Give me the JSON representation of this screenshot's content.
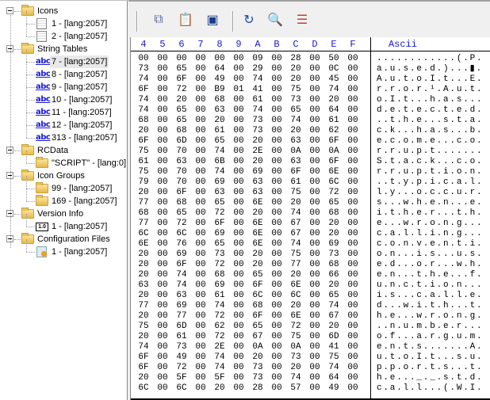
{
  "tree": [
    {
      "level": 0,
      "type": "folder",
      "label": "Icons"
    },
    {
      "level": 1,
      "type": "icon",
      "label": "1 - [lang:2057]"
    },
    {
      "level": 1,
      "type": "icon",
      "label": "2 - [lang:2057]"
    },
    {
      "level": 0,
      "type": "folder",
      "label": "String Tables"
    },
    {
      "level": 1,
      "type": "abc",
      "label": "7 - [lang:2057]",
      "selected": true
    },
    {
      "level": 1,
      "type": "abc",
      "label": "8 - [lang:2057]"
    },
    {
      "level": 1,
      "type": "abc",
      "label": "9 - [lang:2057]"
    },
    {
      "level": 1,
      "type": "abc",
      "label": "10 - [lang:2057]"
    },
    {
      "level": 1,
      "type": "abc",
      "label": "11 - [lang:2057]"
    },
    {
      "level": 1,
      "type": "abc",
      "label": "12 - [lang:2057]"
    },
    {
      "level": 1,
      "type": "abc",
      "label": "313 - [lang:2057]"
    },
    {
      "level": 0,
      "type": "folder",
      "label": "RCData"
    },
    {
      "level": 1,
      "type": "folder",
      "label": "\"SCRIPT\" - [lang:0]"
    },
    {
      "level": 0,
      "type": "folder",
      "label": "Icon Groups"
    },
    {
      "level": 1,
      "type": "folder",
      "label": "99 - [lang:2057]"
    },
    {
      "level": 1,
      "type": "folder",
      "label": "169 - [lang:2057]"
    },
    {
      "level": 0,
      "type": "folder",
      "label": "Version Info"
    },
    {
      "level": 1,
      "type": "version",
      "label": "1 - [lang:2057]"
    },
    {
      "level": 0,
      "type": "folder",
      "label": "Configuration Files"
    },
    {
      "level": 1,
      "type": "config",
      "label": "1 - [lang:2057]"
    }
  ],
  "abc_text": "abc",
  "version_text": "1.0",
  "toolbar": [
    {
      "name": "copy-icon",
      "glyph": "⧉",
      "color": "#5a6fa0"
    },
    {
      "name": "paste-icon",
      "glyph": "📋",
      "color": "#a08040"
    },
    {
      "name": "replace-resource-icon",
      "glyph": "▣",
      "color": "#1a3a8a"
    },
    {
      "name": "refresh-icon",
      "glyph": "↻",
      "color": "#1a4aa0"
    },
    {
      "name": "find-icon",
      "glyph": "🔍",
      "color": "#5080b0"
    },
    {
      "name": "hex-view-icon",
      "glyph": "☰",
      "color": "#c04030"
    }
  ],
  "hex_header": [
    "4",
    "5",
    "6",
    "7",
    "8",
    "9",
    "A",
    "B",
    "C",
    "D",
    "E",
    "F"
  ],
  "ascii_header": "Ascii",
  "rows": [
    {
      "hex": [
        "00",
        "00",
        "00",
        "00",
        "00",
        "00",
        "09",
        "00",
        "28",
        "00",
        "50",
        "00"
      ],
      "ascii": "............(.P."
    },
    {
      "hex": [
        "73",
        "00",
        "65",
        "00",
        "64",
        "00",
        "29",
        "00",
        "20",
        "00",
        "0C",
        "00"
      ],
      "ascii": "a.u.s.e.d.)...▮."
    },
    {
      "hex": [
        "74",
        "00",
        "6F",
        "00",
        "49",
        "00",
        "74",
        "00",
        "20",
        "00",
        "45",
        "00"
      ],
      "ascii": "A.u.t.o.I.t...E."
    },
    {
      "hex": [
        "6F",
        "00",
        "72",
        "00",
        "B9",
        "01",
        "41",
        "00",
        "75",
        "00",
        "74",
        "00"
      ],
      "ascii": "r.r.o.r.¹.A.u.t."
    },
    {
      "hex": [
        "74",
        "00",
        "20",
        "00",
        "68",
        "00",
        "61",
        "00",
        "73",
        "00",
        "20",
        "00"
      ],
      "ascii": "o.I.t...h.a.s..."
    },
    {
      "hex": [
        "74",
        "00",
        "65",
        "00",
        "63",
        "00",
        "74",
        "00",
        "65",
        "00",
        "64",
        "00"
      ],
      "ascii": "d.e.t.e.c.t.e.d."
    },
    {
      "hex": [
        "68",
        "00",
        "65",
        "00",
        "20",
        "00",
        "73",
        "00",
        "74",
        "00",
        "61",
        "00"
      ],
      "ascii": "..t.h.e...s.t.a."
    },
    {
      "hex": [
        "20",
        "00",
        "68",
        "00",
        "61",
        "00",
        "73",
        "00",
        "20",
        "00",
        "62",
        "00"
      ],
      "ascii": "c.k...h.a.s...b."
    },
    {
      "hex": [
        "6F",
        "00",
        "6D",
        "00",
        "65",
        "00",
        "20",
        "00",
        "63",
        "00",
        "6F",
        "00"
      ],
      "ascii": "e.c.o.m.e...c.o."
    },
    {
      "hex": [
        "75",
        "00",
        "70",
        "00",
        "74",
        "00",
        "2E",
        "00",
        "0A",
        "00",
        "0A",
        "00"
      ],
      "ascii": "r.r.u.p.t......."
    },
    {
      "hex": [
        "61",
        "00",
        "63",
        "00",
        "6B",
        "00",
        "20",
        "00",
        "63",
        "00",
        "6F",
        "00"
      ],
      "ascii": "S.t.a.c.k...c.o."
    },
    {
      "hex": [
        "75",
        "00",
        "70",
        "00",
        "74",
        "00",
        "69",
        "00",
        "6F",
        "00",
        "6E",
        "00"
      ],
      "ascii": "r.r.u.p.t.i.o.n."
    },
    {
      "hex": [
        "79",
        "00",
        "70",
        "00",
        "69",
        "00",
        "63",
        "00",
        "61",
        "00",
        "6C",
        "00"
      ],
      "ascii": "..t.y.p.i.c.a.l."
    },
    {
      "hex": [
        "20",
        "00",
        "6F",
        "00",
        "63",
        "00",
        "63",
        "00",
        "75",
        "00",
        "72",
        "00"
      ],
      "ascii": "l.y...o.c.c.u.r."
    },
    {
      "hex": [
        "77",
        "00",
        "68",
        "00",
        "65",
        "00",
        "6E",
        "00",
        "20",
        "00",
        "65",
        "00"
      ],
      "ascii": "s...w.h.e.n...e."
    },
    {
      "hex": [
        "68",
        "00",
        "65",
        "00",
        "72",
        "00",
        "20",
        "00",
        "74",
        "00",
        "68",
        "00"
      ],
      "ascii": "i.t.h.e.r...t.h."
    },
    {
      "hex": [
        "77",
        "00",
        "72",
        "00",
        "6F",
        "00",
        "6E",
        "00",
        "67",
        "00",
        "20",
        "00"
      ],
      "ascii": "e...w.r.o.n.g..."
    },
    {
      "hex": [
        "6C",
        "00",
        "6C",
        "00",
        "69",
        "00",
        "6E",
        "00",
        "67",
        "00",
        "20",
        "00"
      ],
      "ascii": "c.a.l.l.i.n.g..."
    },
    {
      "hex": [
        "6E",
        "00",
        "76",
        "00",
        "65",
        "00",
        "6E",
        "00",
        "74",
        "00",
        "69",
        "00"
      ],
      "ascii": "c.o.n.v.e.n.t.i."
    },
    {
      "hex": [
        "20",
        "00",
        "69",
        "00",
        "73",
        "00",
        "20",
        "00",
        "75",
        "00",
        "73",
        "00"
      ],
      "ascii": "o.n...i.s...u.s."
    },
    {
      "hex": [
        "20",
        "00",
        "6F",
        "00",
        "72",
        "00",
        "20",
        "00",
        "77",
        "00",
        "68",
        "00"
      ],
      "ascii": "e.d...o.r...w.h."
    },
    {
      "hex": [
        "20",
        "00",
        "74",
        "00",
        "68",
        "00",
        "65",
        "00",
        "20",
        "00",
        "66",
        "00"
      ],
      "ascii": "e.n...t.h.e...f."
    },
    {
      "hex": [
        "63",
        "00",
        "74",
        "00",
        "69",
        "00",
        "6F",
        "00",
        "6E",
        "00",
        "20",
        "00"
      ],
      "ascii": "u.n.c.t.i.o.n..."
    },
    {
      "hex": [
        "20",
        "00",
        "63",
        "00",
        "61",
        "00",
        "6C",
        "00",
        "6C",
        "00",
        "65",
        "00"
      ],
      "ascii": "i.s...c.a.l.l.e."
    },
    {
      "hex": [
        "77",
        "00",
        "69",
        "00",
        "74",
        "00",
        "68",
        "00",
        "20",
        "00",
        "74",
        "00"
      ],
      "ascii": "d...w.i.t.h...t."
    },
    {
      "hex": [
        "20",
        "00",
        "77",
        "00",
        "72",
        "00",
        "6F",
        "00",
        "6E",
        "00",
        "67",
        "00"
      ],
      "ascii": "h.e...w.r.o.n.g."
    },
    {
      "hex": [
        "75",
        "00",
        "6D",
        "00",
        "62",
        "00",
        "65",
        "00",
        "72",
        "00",
        "20",
        "00"
      ],
      "ascii": "..n.u.m.b.e.r..."
    },
    {
      "hex": [
        "20",
        "00",
        "61",
        "00",
        "72",
        "00",
        "67",
        "00",
        "75",
        "00",
        "6D",
        "00"
      ],
      "ascii": "o.f...a.r.g.u.m."
    },
    {
      "hex": [
        "74",
        "00",
        "73",
        "00",
        "2E",
        "00",
        "0A",
        "00",
        "0A",
        "00",
        "41",
        "00"
      ],
      "ascii": "e.n.t.s.......A."
    },
    {
      "hex": [
        "6F",
        "00",
        "49",
        "00",
        "74",
        "00",
        "20",
        "00",
        "73",
        "00",
        "75",
        "00"
      ],
      "ascii": "u.t.o.I.t...s.u."
    },
    {
      "hex": [
        "6F",
        "00",
        "72",
        "00",
        "74",
        "00",
        "73",
        "00",
        "20",
        "00",
        "74",
        "00"
      ],
      "ascii": "p.p.o.r.t.s...t."
    },
    {
      "hex": [
        "20",
        "00",
        "5F",
        "00",
        "5F",
        "00",
        "73",
        "00",
        "74",
        "00",
        "64",
        "00"
      ],
      "ascii": "h.e..._._.s.t.d."
    },
    {
      "hex": [
        "6C",
        "00",
        "6C",
        "00",
        "20",
        "00",
        "28",
        "00",
        "57",
        "00",
        "49",
        "00"
      ],
      "ascii": "c.a.l.l...(.W.I."
    }
  ]
}
